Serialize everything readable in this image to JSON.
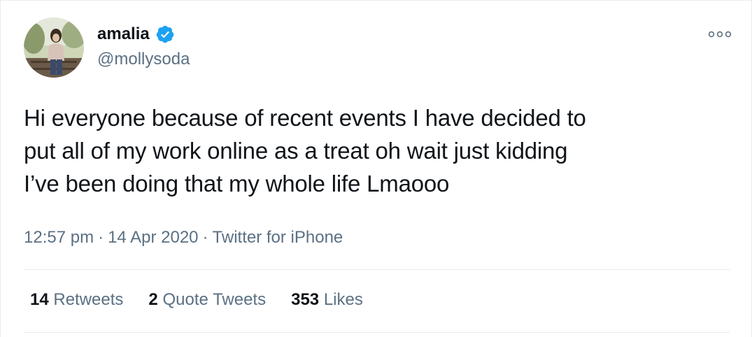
{
  "author": {
    "display_name": "amalia",
    "handle": "@mollysoda"
  },
  "tweet": {
    "lines": [
      "Hi everyone because of recent events I have decided to",
      "put all of my work online as a treat oh wait just kidding",
      "I’ve been doing that my whole life Lmaooo"
    ]
  },
  "meta": {
    "time": "12:57 pm",
    "separator": "·",
    "date": "14 Apr 2020",
    "source": "Twitter for iPhone"
  },
  "stats": {
    "retweets": {
      "count": "14",
      "label": "Retweets"
    },
    "quotes": {
      "count": "2",
      "label": "Quote Tweets"
    },
    "likes": {
      "count": "353",
      "label": "Likes"
    }
  },
  "colors": {
    "text": "#0f1419",
    "secondary": "#5b7083",
    "verified": "#1da1f2",
    "divider": "#e6ecf0"
  },
  "icons": {
    "verified": "verified-badge-icon",
    "more": "more-options-icon"
  }
}
